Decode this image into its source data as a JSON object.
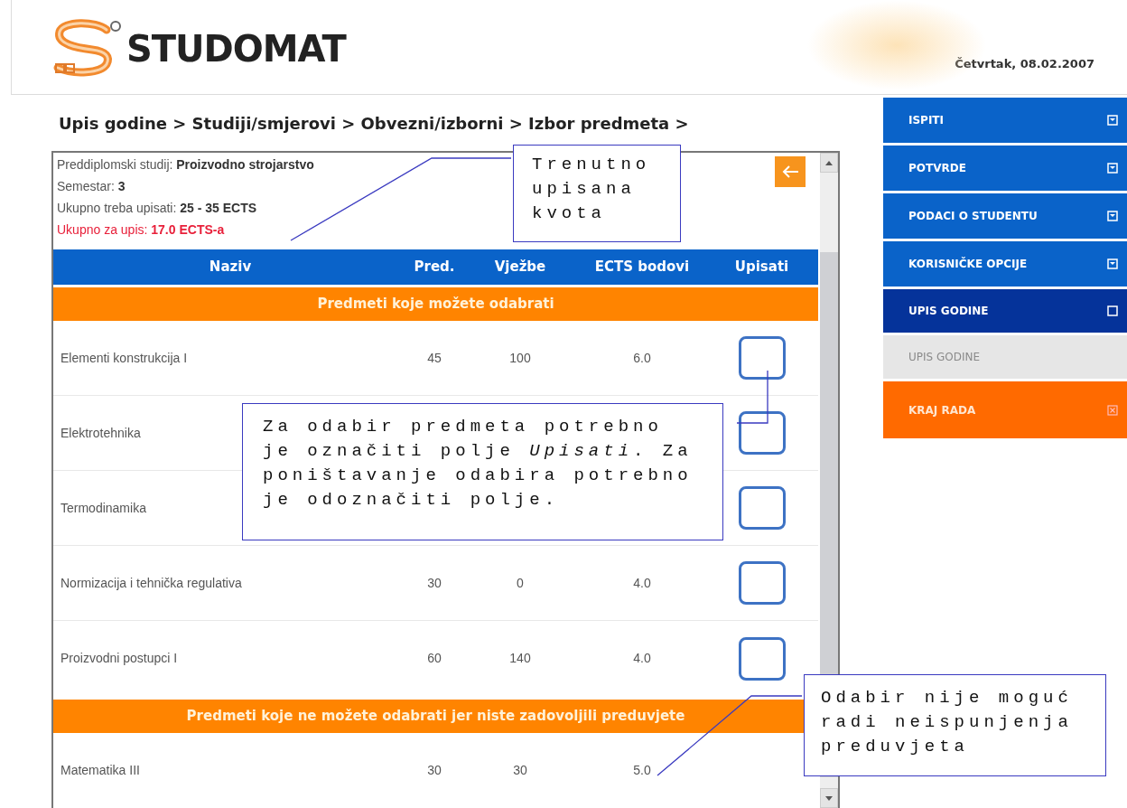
{
  "header": {
    "logo_text": "STUDOMAT",
    "date": "Četvrtak, 08.02.2007"
  },
  "breadcrumb": "Upis godine > Studiji/smjerovi > Obvezni/izborni > Izbor predmeta >",
  "info": [
    {
      "label": "Preddiplomski studij: ",
      "value": "Proizvodno strojarstvo",
      "highlight": false
    },
    {
      "label": "Semestar: ",
      "value": "3",
      "highlight": false
    },
    {
      "label": "Ukupno treba upisati: ",
      "value": "25 - 35 ECTS",
      "highlight": false
    },
    {
      "label": "Ukupno za upis: ",
      "value": "17.0 ECTS-a",
      "highlight": true
    }
  ],
  "table": {
    "columns": [
      "Naziv",
      "Pred.",
      "Vježbe",
      "ECTS bodovi",
      "Upisati"
    ],
    "sections": [
      {
        "title": "Predmeti koje možete odabrati",
        "rows": [
          {
            "name": "Elementi konstrukcija I",
            "pred": "45",
            "vjezbe": "100",
            "ects": "6.0",
            "selectable": true,
            "checked": false
          },
          {
            "name": "Elektrotehnika",
            "selectable": true,
            "checked": false
          },
          {
            "name": "Termodinamika",
            "selectable": true,
            "checked": false
          },
          {
            "name": "Normizacija i tehnička regulativa",
            "pred": "30",
            "vjezbe": "0",
            "ects": "4.0",
            "selectable": true,
            "checked": false
          },
          {
            "name": "Proizvodni postupci I",
            "pred": "60",
            "vjezbe": "140",
            "ects": "4.0",
            "selectable": true,
            "checked": false
          }
        ]
      },
      {
        "title": "Predmeti koje ne možete odabrati jer niste zadovoljili preduvjete",
        "rows": [
          {
            "name": "Matematika III",
            "pred": "30",
            "vjezbe": "30",
            "ects": "5.0",
            "selectable": false
          }
        ]
      }
    ]
  },
  "sidebar": [
    {
      "label": "ISPITI",
      "kind": "menu"
    },
    {
      "label": "POTVRDE",
      "kind": "menu"
    },
    {
      "label": "PODACI O STUDENTU",
      "kind": "menu"
    },
    {
      "label": "KORISNIČKE OPCIJE",
      "kind": "menu"
    },
    {
      "label": "UPIS GODINE",
      "kind": "active"
    },
    {
      "label": "UPIS GODINE",
      "kind": "sub"
    },
    {
      "label": "KRAJ RADA",
      "kind": "exit"
    }
  ],
  "callouts": [
    {
      "lines": [
        "Trenutno",
        "upisana",
        "kvota"
      ]
    },
    {
      "lines": [
        "Za odabir predmeta potrebno",
        "je označiti polje *Upisati*. Za",
        "poništavanje odabira potrebno",
        "je odoznačiti polje."
      ]
    },
    {
      "lines": [
        "Odabir nije moguć",
        "radi neispunjenja",
        "preduvjeta"
      ]
    }
  ]
}
